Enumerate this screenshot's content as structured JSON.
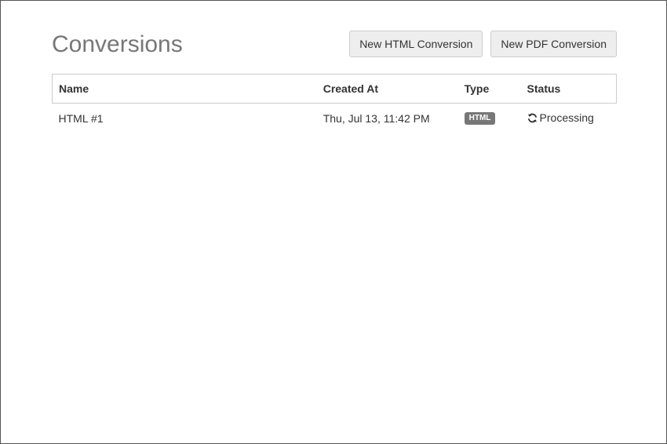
{
  "header": {
    "title": "Conversions",
    "buttons": {
      "new_html": "New HTML Conversion",
      "new_pdf": "New PDF Conversion"
    }
  },
  "table": {
    "columns": {
      "name": "Name",
      "created_at": "Created At",
      "type": "Type",
      "status": "Status"
    },
    "rows": [
      {
        "name": "HTML #1",
        "created_at": "Thu, Jul 13, 11:42 PM",
        "type": "HTML",
        "status": "Processing",
        "status_icon": "refresh-icon"
      }
    ]
  },
  "colors": {
    "title": "#777777",
    "badge_bg": "#777777",
    "button_bg": "#eeeeee",
    "border": "#cccccc"
  }
}
